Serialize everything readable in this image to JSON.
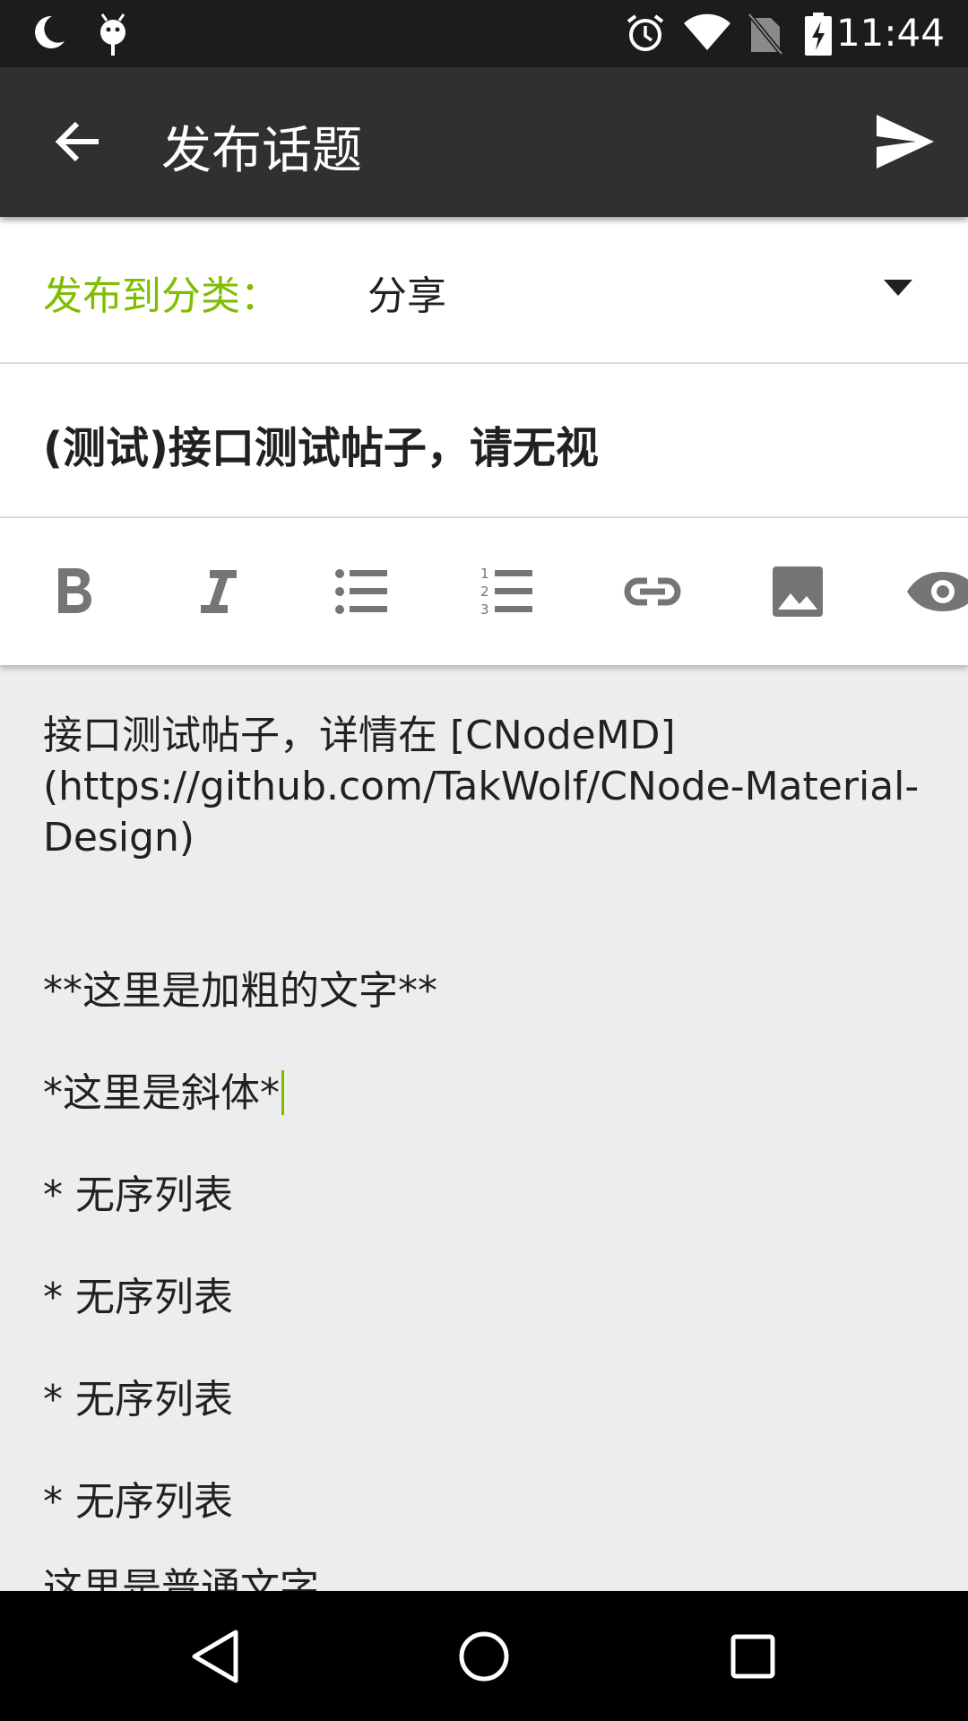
{
  "status_bar": {
    "time": "11:44",
    "icons": [
      "moon-icon",
      "android-debug-icon",
      "alarm-icon",
      "wifi-icon",
      "no-sim-icon",
      "battery-charging-icon"
    ]
  },
  "toolbar": {
    "title": "发布话题",
    "back_icon": "arrow-back-icon",
    "send_icon": "send-icon"
  },
  "category": {
    "label": "发布到分类：",
    "value": "分享"
  },
  "topic_title": "(测试)接口测试帖子，请无视",
  "format_toolbar": [
    "bold-icon",
    "italic-icon",
    "bulleted-list-icon",
    "numbered-list-icon",
    "link-icon",
    "image-icon",
    "preview-eye-icon"
  ],
  "content": {
    "line1": "接口测试帖子，详情在 [CNodeMD](https://github.com/TakWolf/CNode-Material-Design)",
    "line2": "**这里是加粗的文字**",
    "line3": "*这里是斜体*",
    "list1": "* 无序列表",
    "list2": "* 无序列表",
    "list3": "* 无序列表",
    "list4": "* 无序列表",
    "line4": "这里是普通文字"
  },
  "colors": {
    "accent": "#80bd01",
    "toolbar": "#303030",
    "status_bar": "#1c1c1c",
    "content_bg": "#ededed"
  },
  "nav_bar": [
    "nav-back-icon",
    "nav-home-icon",
    "nav-recents-icon"
  ]
}
